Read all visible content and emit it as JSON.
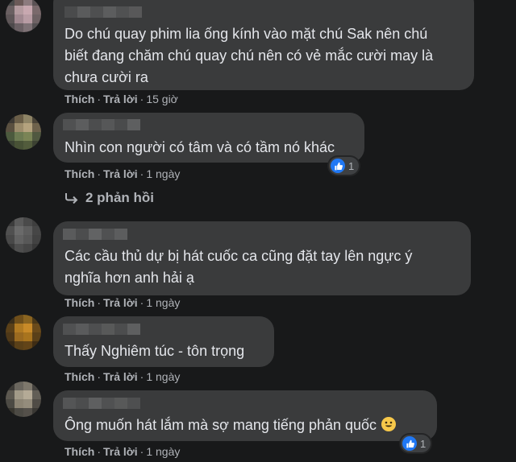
{
  "comments": [
    {
      "text_lines": [
        "Do chú quay phim lia ống kính vào mặt chú Sak nên chú",
        "biết đang chăm chú quay chú nên có vẻ mắc cười may là",
        "chưa cười ra"
      ],
      "like": "Thích",
      "reply": "Trả lời",
      "time": "15 giờ"
    },
    {
      "text_lines": [
        "Nhìn con người có tâm và có tầm nó khác"
      ],
      "like": "Thích",
      "reply": "Trả lời",
      "time": "1 ngày",
      "reaction_count": "1"
    },
    {
      "text_lines": [
        "Các cầu thủ dự bị hát cuốc ca cũng đặt tay lên ngực ý",
        "nghĩa hơn anh hải ạ"
      ],
      "like": "Thích",
      "reply": "Trả lời",
      "time": "1 ngày"
    },
    {
      "text_lines": [
        "Thấy Nghiêm túc - tôn trọng"
      ],
      "like": "Thích",
      "reply": "Trả lời",
      "time": "1 ngày"
    },
    {
      "text_lines": [
        "Ông muốn hát lắm mà sợ mang tiếng phản quốc"
      ],
      "like": "Thích",
      "reply": "Trả lời",
      "time": "1 ngày",
      "reaction_count": "1",
      "emoji": "smiling-face-emoji"
    }
  ],
  "replies_label": "2 phản hồi",
  "colors": {
    "background": "#18191a",
    "bubble": "#3a3b3c",
    "text": "#e4e6eb",
    "secondary_text": "#b0b3b8",
    "like_blue": "#2078f4"
  }
}
